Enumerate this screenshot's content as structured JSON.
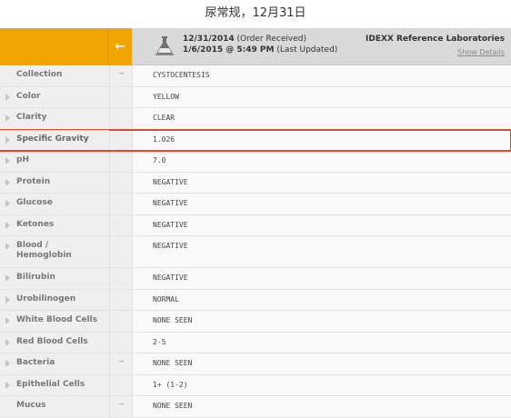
{
  "caption": "尿常规，12月31日",
  "header": {
    "back_icon": "arrow-left-icon",
    "flask_icon": "flask-icon",
    "order_date": "12/31/2014",
    "order_status": "(Order Received)",
    "updated_date": "1/6/2015 @ 5:49 PM",
    "updated_status": "(Last Updated)",
    "lab_name": "IDEXX Reference Laboratories",
    "show_details": "Show Details"
  },
  "rows": [
    {
      "label": "Collection",
      "marker": "→",
      "value": "CYSTOCENTESIS"
    },
    {
      "label": "Color",
      "marker": "",
      "value": "YELLOW"
    },
    {
      "label": "Clarity",
      "marker": "",
      "value": "CLEAR"
    },
    {
      "label": "Specific Gravity",
      "marker": "",
      "value": "1.026"
    },
    {
      "label": "pH",
      "marker": "",
      "value": "7.0"
    },
    {
      "label": "Protein",
      "marker": "",
      "value": "NEGATIVE"
    },
    {
      "label": "Glucose",
      "marker": "",
      "value": "NEGATIVE"
    },
    {
      "label": "Ketones",
      "marker": "",
      "value": "NEGATIVE"
    },
    {
      "label": "Blood / Hemoglobin",
      "marker": "",
      "value": "NEGATIVE"
    },
    {
      "label": "Bilirubin",
      "marker": "",
      "value": "NEGATIVE"
    },
    {
      "label": "Urobilinogen",
      "marker": "",
      "value": "NORMAL"
    },
    {
      "label": "White Blood Cells",
      "marker": "",
      "value": "NONE SEEN"
    },
    {
      "label": "Red Blood Cells",
      "marker": "",
      "value": "2-5"
    },
    {
      "label": "Bacteria",
      "marker": "→",
      "value": "NONE SEEN"
    },
    {
      "label": "Epithelial Cells",
      "marker": "",
      "value": "1+ (1-2)"
    },
    {
      "label": "Mucus",
      "marker": "→",
      "value": "NONE SEEN"
    }
  ],
  "highlight_color": "#e04a32",
  "accent_color": "#f0a500"
}
